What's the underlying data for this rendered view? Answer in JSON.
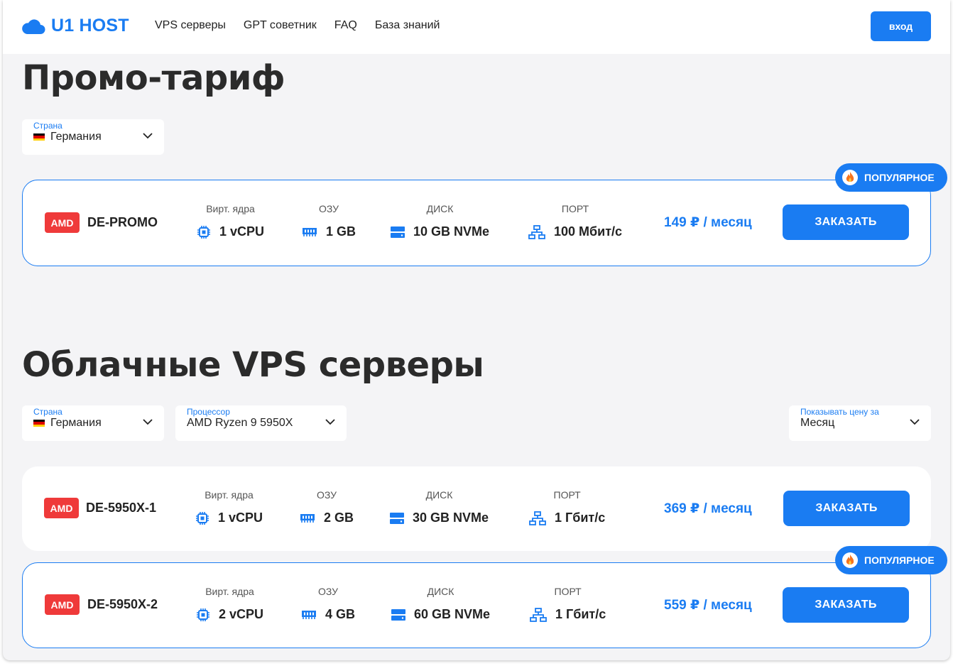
{
  "header": {
    "logo_text": "U1 HOST",
    "nav": [
      "VPS серверы",
      "GPT советник",
      "FAQ",
      "База знаний"
    ],
    "login_label": "вход"
  },
  "promo": {
    "title": "Промо-тариф",
    "country": {
      "label": "Страна",
      "value": "Германия"
    },
    "badge": "ПОПУЛЯРНОЕ",
    "plans": [
      {
        "brand": "AMD",
        "name": "DE-PROMO",
        "cpu_label": "Вирт. ядра",
        "cpu": "1 vCPU",
        "ram_label": "ОЗУ",
        "ram": "1 GB",
        "disk_label": "ДИСК",
        "disk": "10 GB NVMe",
        "port_label": "ПОРТ",
        "port": "100 Мбит/с",
        "price": "149 ₽ / месяц",
        "order": "ЗАКАЗАТЬ"
      }
    ]
  },
  "vps": {
    "title": "Облачные VPS серверы",
    "country": {
      "label": "Страна",
      "value": "Германия"
    },
    "cpu_filter": {
      "label": "Процессор",
      "value": "AMD Ryzen 9 5950X"
    },
    "period": {
      "label": "Показывать цену за",
      "value": "Месяц"
    },
    "badge": "ПОПУЛЯРНОЕ",
    "plans": [
      {
        "brand": "AMD",
        "name": "DE-5950X-1",
        "cpu_label": "Вирт. ядра",
        "cpu": "1 vCPU",
        "ram_label": "ОЗУ",
        "ram": "2 GB",
        "disk_label": "ДИСК",
        "disk": "30 GB NVMe",
        "port_label": "ПОРТ",
        "port": "1 Гбит/с",
        "price": "369 ₽ / месяц",
        "order": "ЗАКАЗАТЬ"
      },
      {
        "brand": "AMD",
        "name": "DE-5950X-2",
        "cpu_label": "Вирт. ядра",
        "cpu": "2 vCPU",
        "ram_label": "ОЗУ",
        "ram": "4 GB",
        "disk_label": "ДИСК",
        "disk": "60 GB NVMe",
        "port_label": "ПОРТ",
        "port": "1 Гбит/с",
        "price": "559 ₽ / месяц",
        "order": "ЗАКАЗАТЬ"
      }
    ]
  },
  "icons": [
    "cloud-icon",
    "cpu-icon",
    "ram-icon",
    "disk-icon",
    "network-icon",
    "fire-icon",
    "chevron-down-icon",
    "germany-flag-icon"
  ],
  "colors": {
    "accent": "#1a7cf2",
    "amd_badge": "#ef3a3a",
    "background": "#f4f4f6"
  }
}
